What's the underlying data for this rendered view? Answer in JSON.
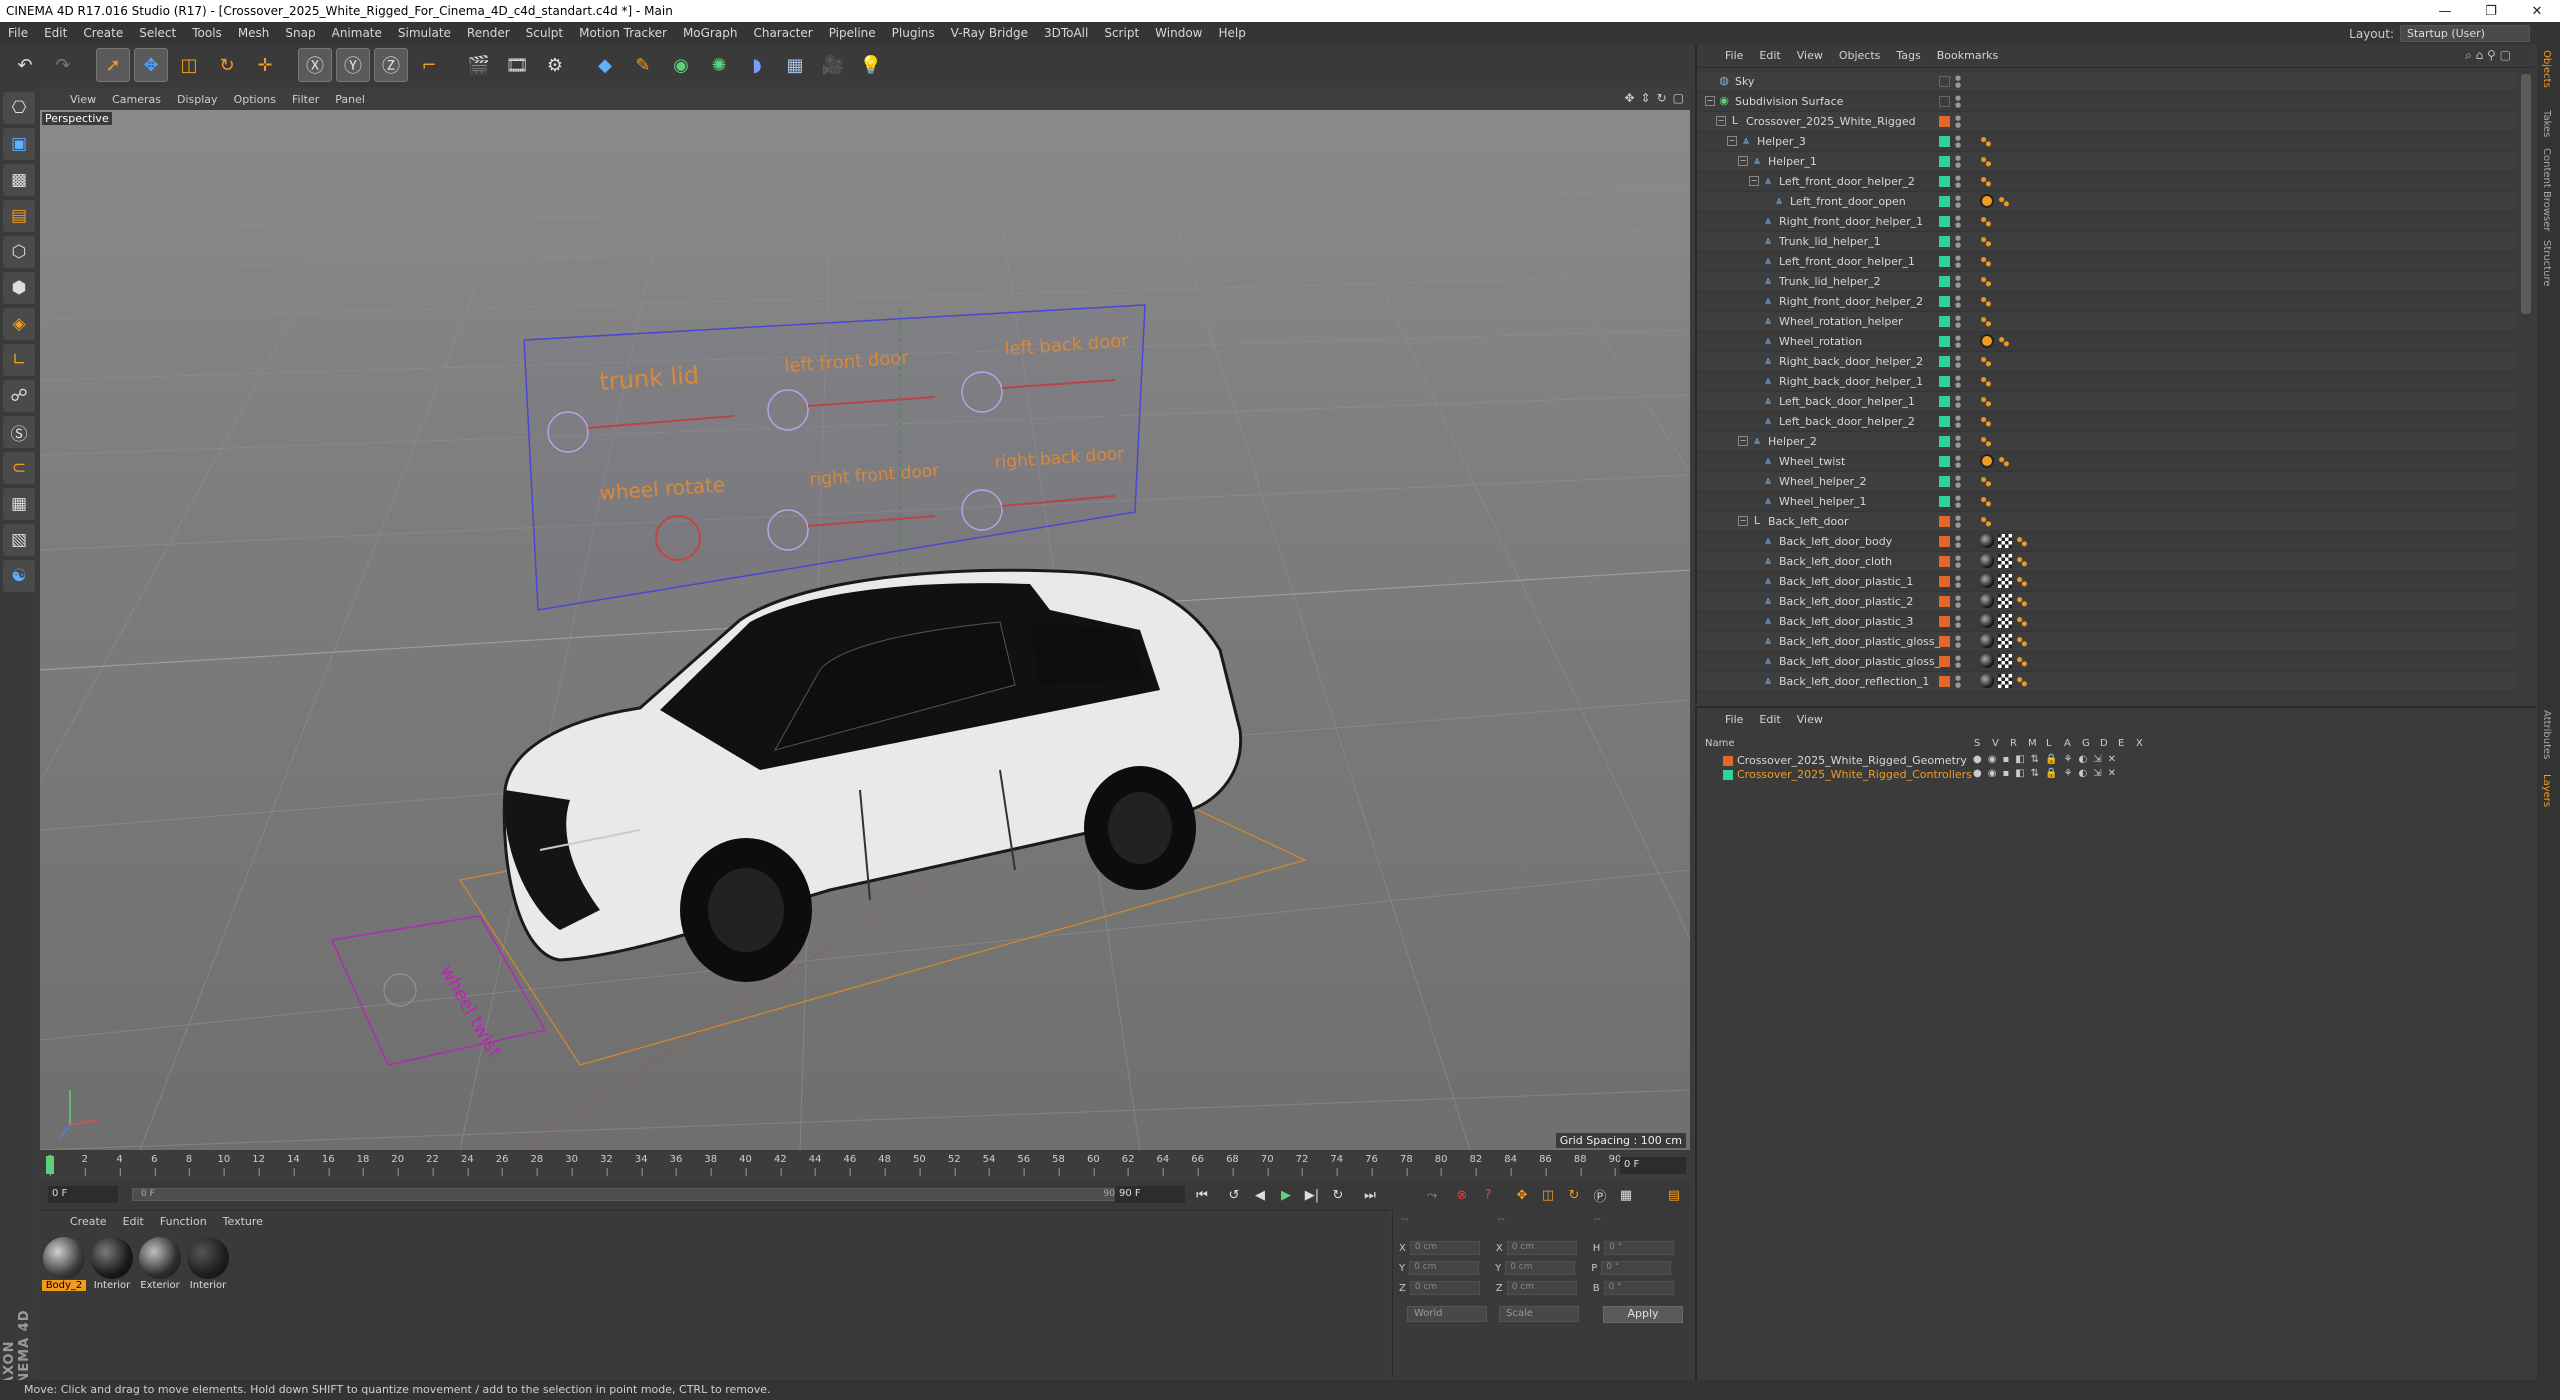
{
  "titlebar": {
    "title": "CINEMA 4D R17.016 Studio (R17) - [Crossover_2025_White_Rigged_For_Cinema_4D_c4d_standart.c4d *] - Main",
    "minimize": "—",
    "restore": "❐",
    "close": "✕"
  },
  "menubar": {
    "items": [
      "File",
      "Edit",
      "Create",
      "Select",
      "Tools",
      "Mesh",
      "Snap",
      "Animate",
      "Simulate",
      "Render",
      "Sculpt",
      "Motion Tracker",
      "MoGraph",
      "Character",
      "Pipeline",
      "Plugins",
      "V-Ray Bridge",
      "3DToAll",
      "Script",
      "Window",
      "Help"
    ],
    "layout_label": "Layout:",
    "layout_value": "Startup (User)"
  },
  "viewport": {
    "menu": [
      "View",
      "Cameras",
      "Display",
      "Options",
      "Filter",
      "Panel"
    ],
    "label": "Perspective",
    "grid_spacing": "Grid Spacing : 100 cm",
    "controller_labels": [
      "trunk lid",
      "left front door",
      "left back door",
      "wheel rotate",
      "right front door",
      "right back door"
    ],
    "wheel_twist_label": "wheel twist"
  },
  "timeline": {
    "ticks": [
      "0",
      "2",
      "4",
      "6",
      "8",
      "10",
      "12",
      "14",
      "16",
      "18",
      "20",
      "22",
      "24",
      "26",
      "28",
      "30",
      "32",
      "34",
      "36",
      "38",
      "40",
      "42",
      "44",
      "46",
      "48",
      "50",
      "52",
      "54",
      "56",
      "58",
      "60",
      "62",
      "64",
      "66",
      "68",
      "70",
      "72",
      "74",
      "76",
      "78",
      "80",
      "82",
      "84",
      "86",
      "88",
      "90"
    ],
    "frame": "0 F"
  },
  "playback": {
    "start": "0 F",
    "slider_left": "0 F",
    "slider_right": "90 F",
    "end": "90 F"
  },
  "materials": {
    "menu": [
      "Create",
      "Edit",
      "Function",
      "Texture"
    ],
    "items": [
      {
        "label": "Body_2",
        "active": true
      },
      {
        "label": "Interior",
        "active": false
      },
      {
        "label": "Exterior",
        "active": false
      },
      {
        "label": "Interior",
        "active": false
      }
    ]
  },
  "coords": {
    "header": "--",
    "rows": [
      {
        "a": "X",
        "av": "0 cm",
        "b": "X",
        "bv": "0 cm",
        "c": "H",
        "cv": "0 °"
      },
      {
        "a": "Y",
        "av": "0 cm",
        "b": "Y",
        "bv": "0 cm",
        "c": "P",
        "cv": "0 °"
      },
      {
        "a": "Z",
        "av": "0 cm",
        "b": "Z",
        "bv": "0 cm",
        "c": "B",
        "cv": "0 °"
      }
    ],
    "world": "World",
    "scale": "Scale",
    "apply": "Apply"
  },
  "status": "Move: Click and drag to move elements. Hold down SHIFT to quantize movement / add to the selection in point mode, CTRL to remove.",
  "objects": {
    "menu": [
      "File",
      "Edit",
      "View",
      "Objects",
      "Tags",
      "Bookmarks"
    ],
    "rows": [
      {
        "name": "Sky",
        "depth": 0,
        "icon": "sky",
        "layer": "none",
        "tags": []
      },
      {
        "name": "Subdivision Surface",
        "depth": 0,
        "icon": "subdiv",
        "layer": "none",
        "tags": []
      },
      {
        "name": "Crossover_2025_White_Rigged",
        "depth": 1,
        "icon": "null",
        "layer": "orange",
        "tags": []
      },
      {
        "name": "Helper_3",
        "depth": 2,
        "icon": "helper",
        "layer": "green",
        "tags": [
          "dots"
        ]
      },
      {
        "name": "Helper_1",
        "depth": 3,
        "icon": "helper",
        "layer": "green",
        "tags": [
          "dots"
        ]
      },
      {
        "name": "Left_front_door_helper_2",
        "depth": 4,
        "icon": "helper",
        "layer": "green",
        "tags": [
          "dots"
        ]
      },
      {
        "name": "Left_front_door_open",
        "depth": 5,
        "icon": "helper",
        "layer": "green",
        "tags": [
          "xpresso",
          "dots"
        ]
      },
      {
        "name": "Right_front_door_helper_1",
        "depth": 4,
        "icon": "helper",
        "layer": "green",
        "tags": [
          "dots"
        ]
      },
      {
        "name": "Trunk_lid_helper_1",
        "depth": 4,
        "icon": "helper",
        "layer": "green",
        "tags": [
          "dots"
        ]
      },
      {
        "name": "Left_front_door_helper_1",
        "depth": 4,
        "icon": "helper",
        "layer": "green",
        "tags": [
          "dots"
        ]
      },
      {
        "name": "Trunk_lid_helper_2",
        "depth": 4,
        "icon": "helper",
        "layer": "green",
        "tags": [
          "dots"
        ]
      },
      {
        "name": "Right_front_door_helper_2",
        "depth": 4,
        "icon": "helper",
        "layer": "green",
        "tags": [
          "dots"
        ]
      },
      {
        "name": "Wheel_rotation_helper",
        "depth": 4,
        "icon": "helper",
        "layer": "green",
        "tags": [
          "dots"
        ]
      },
      {
        "name": "Wheel_rotation",
        "depth": 4,
        "icon": "helper",
        "layer": "green",
        "tags": [
          "xpresso",
          "dots"
        ]
      },
      {
        "name": "Right_back_door_helper_2",
        "depth": 4,
        "icon": "helper",
        "layer": "green",
        "tags": [
          "dots"
        ]
      },
      {
        "name": "Right_back_door_helper_1",
        "depth": 4,
        "icon": "helper",
        "layer": "green",
        "tags": [
          "dots"
        ]
      },
      {
        "name": "Left_back_door_helper_1",
        "depth": 4,
        "icon": "helper",
        "layer": "green",
        "tags": [
          "dots"
        ]
      },
      {
        "name": "Left_back_door_helper_2",
        "depth": 4,
        "icon": "helper",
        "layer": "green",
        "tags": [
          "dots"
        ]
      },
      {
        "name": "Helper_2",
        "depth": 3,
        "icon": "helper",
        "layer": "green",
        "tags": [
          "dots"
        ]
      },
      {
        "name": "Wheel_twist",
        "depth": 4,
        "icon": "helper",
        "layer": "green",
        "tags": [
          "xpresso",
          "dots"
        ]
      },
      {
        "name": "Wheel_helper_2",
        "depth": 4,
        "icon": "helper",
        "layer": "green",
        "tags": [
          "dots"
        ]
      },
      {
        "name": "Wheel_helper_1",
        "depth": 4,
        "icon": "helper",
        "layer": "green",
        "tags": [
          "dots"
        ]
      },
      {
        "name": "Back_left_door",
        "depth": 3,
        "icon": "null",
        "layer": "orange",
        "tags": [
          "dots"
        ]
      },
      {
        "name": "Back_left_door_body",
        "depth": 4,
        "icon": "helper",
        "layer": "orange",
        "tags": [
          "mat",
          "check",
          "dots"
        ]
      },
      {
        "name": "Back_left_door_cloth",
        "depth": 4,
        "icon": "helper",
        "layer": "orange",
        "tags": [
          "mat",
          "check",
          "dots"
        ]
      },
      {
        "name": "Back_left_door_plastic_1",
        "depth": 4,
        "icon": "helper",
        "layer": "orange",
        "tags": [
          "mat",
          "check",
          "dots"
        ]
      },
      {
        "name": "Back_left_door_plastic_2",
        "depth": 4,
        "icon": "helper",
        "layer": "orange",
        "tags": [
          "mat",
          "check",
          "dots"
        ]
      },
      {
        "name": "Back_left_door_plastic_3",
        "depth": 4,
        "icon": "helper",
        "layer": "orange",
        "tags": [
          "mat",
          "check",
          "dots"
        ]
      },
      {
        "name": "Back_left_door_plastic_gloss_1",
        "depth": 4,
        "icon": "helper",
        "layer": "orange",
        "tags": [
          "mat",
          "check",
          "dots"
        ]
      },
      {
        "name": "Back_left_door_plastic_gloss_2",
        "depth": 4,
        "icon": "helper",
        "layer": "orange",
        "tags": [
          "mat",
          "check",
          "dots"
        ]
      },
      {
        "name": "Back_left_door_reflection_1",
        "depth": 4,
        "icon": "helper",
        "layer": "orange",
        "tags": [
          "mat",
          "check",
          "dots"
        ]
      }
    ]
  },
  "layers": {
    "menu": [
      "File",
      "Edit",
      "View"
    ],
    "head": {
      "name": "Name",
      "cols": [
        "S",
        "V",
        "R",
        "M",
        "L",
        "A",
        "G",
        "D",
        "E",
        "X"
      ]
    },
    "rows": [
      {
        "name": "Crossover_2025_White_Rigged_Geometry",
        "color": "#e0682a",
        "highlight": false
      },
      {
        "name": "Crossover_2025_White_Rigged_Controllers",
        "color": "#2fd39a",
        "highlight": true
      }
    ]
  },
  "sidetabs": [
    "Objects",
    "Takes",
    "Content Browser",
    "Structure",
    "Attributes",
    "Layers"
  ],
  "colors": {
    "accent": "#f29b21",
    "layer_green": "#2fd39a",
    "layer_orange": "#e0682a",
    "viewport_bg": "#8e8e8e"
  }
}
